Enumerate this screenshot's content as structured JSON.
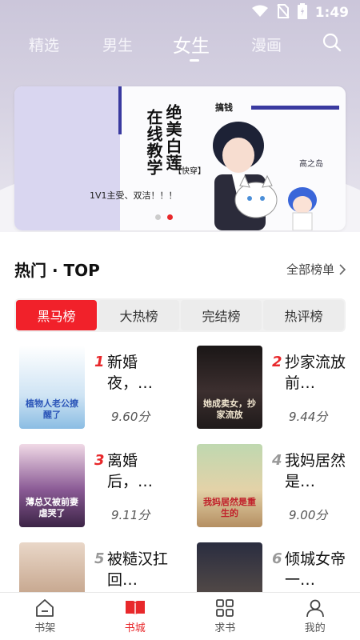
{
  "status_bar": {
    "time": "1:49"
  },
  "top_nav": {
    "tabs": [
      {
        "label": "精选"
      },
      {
        "label": "男生"
      },
      {
        "label": "女生"
      },
      {
        "label": "漫画"
      }
    ],
    "active_index": 2
  },
  "banner": {
    "title_col1": "在线教学",
    "title_col2": "绝美白莲",
    "tag": "【快穿】",
    "subtitle": "1V1主受、双洁！！！",
    "brand": "搞钱",
    "side_name": "高之岛",
    "slides": 2,
    "active_slide": 1
  },
  "section": {
    "title": "热门 · TOP",
    "more": "全部榜单"
  },
  "rank_tabs": [
    {
      "label": "黑马榜"
    },
    {
      "label": "大热榜"
    },
    {
      "label": "完结榜"
    },
    {
      "label": "热评榜"
    }
  ],
  "books": [
    {
      "rank": "1",
      "name": "新婚夜，…",
      "score": "9.60分",
      "cover_text": "植物人老公撩醒了",
      "cover_color": "#cfe4f4",
      "rank_color": "#e8282b"
    },
    {
      "rank": "2",
      "name": "抄家流放前…",
      "score": "9.44分",
      "cover_text": "她成卖女，抄家流放",
      "cover_color": "#2a2424",
      "rank_color": "#e8282b"
    },
    {
      "rank": "3",
      "name": "离婚后，…",
      "score": "9.11分",
      "cover_text": "薄总又被前妻虐哭了",
      "cover_color": "#6a3a72",
      "rank_color": "#e8282b"
    },
    {
      "rank": "4",
      "name": "我妈居然是…",
      "score": "9.00分",
      "cover_text": "我妈居然是重生的",
      "cover_color": "#d9c9a0",
      "rank_color": "#999999"
    },
    {
      "rank": "5",
      "name": "被糙汉扛回…",
      "score": "",
      "cover_text": "",
      "cover_color": "#c8a58a",
      "rank_color": "#999999"
    },
    {
      "rank": "6",
      "name": "倾城女帝一…",
      "score": "",
      "cover_text": "",
      "cover_color": "#3a3a4a",
      "rank_color": "#999999"
    }
  ],
  "bottom_nav": [
    {
      "label": "书架",
      "icon": "home-icon"
    },
    {
      "label": "书城",
      "icon": "book-icon"
    },
    {
      "label": "求书",
      "icon": "grid-icon"
    },
    {
      "label": "我的",
      "icon": "user-icon"
    }
  ],
  "colors": {
    "accent": "#e8282b",
    "top_bg": "#cbc6da"
  }
}
